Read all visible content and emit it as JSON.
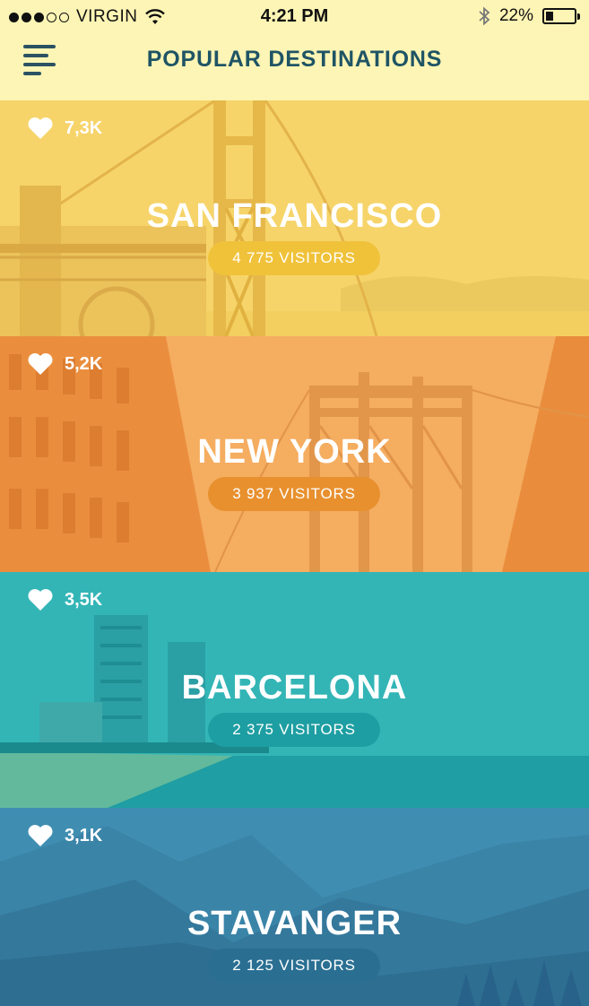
{
  "status": {
    "carrier": "VIRGIN",
    "time": "4:21 PM",
    "battery": "22%",
    "battery_level": 0.22
  },
  "header": {
    "title": "POPULAR DESTINATIONS",
    "menu_icon": "hamburger-menu-icon"
  },
  "destinations": [
    {
      "name": "SAN FRANCISCO",
      "likes": "7,3K",
      "visitors": "4 775 VISITORS",
      "color": "#f5cf61",
      "pill": "#f0c23a"
    },
    {
      "name": "NEW YORK",
      "likes": "5,2K",
      "visitors": "3 937 VISITORS",
      "color": "#f3a252",
      "pill": "#e8902e"
    },
    {
      "name": "BARCELONA",
      "likes": "3,5K",
      "visitors": "2 375 VISITORS",
      "color": "#2eb0b2",
      "pill": "#1d9ea2"
    },
    {
      "name": "STAVANGER",
      "likes": "3,1K",
      "visitors": "2 125 VISITORS",
      "color": "#3a88ac",
      "pill": "#2a6f92"
    }
  ]
}
